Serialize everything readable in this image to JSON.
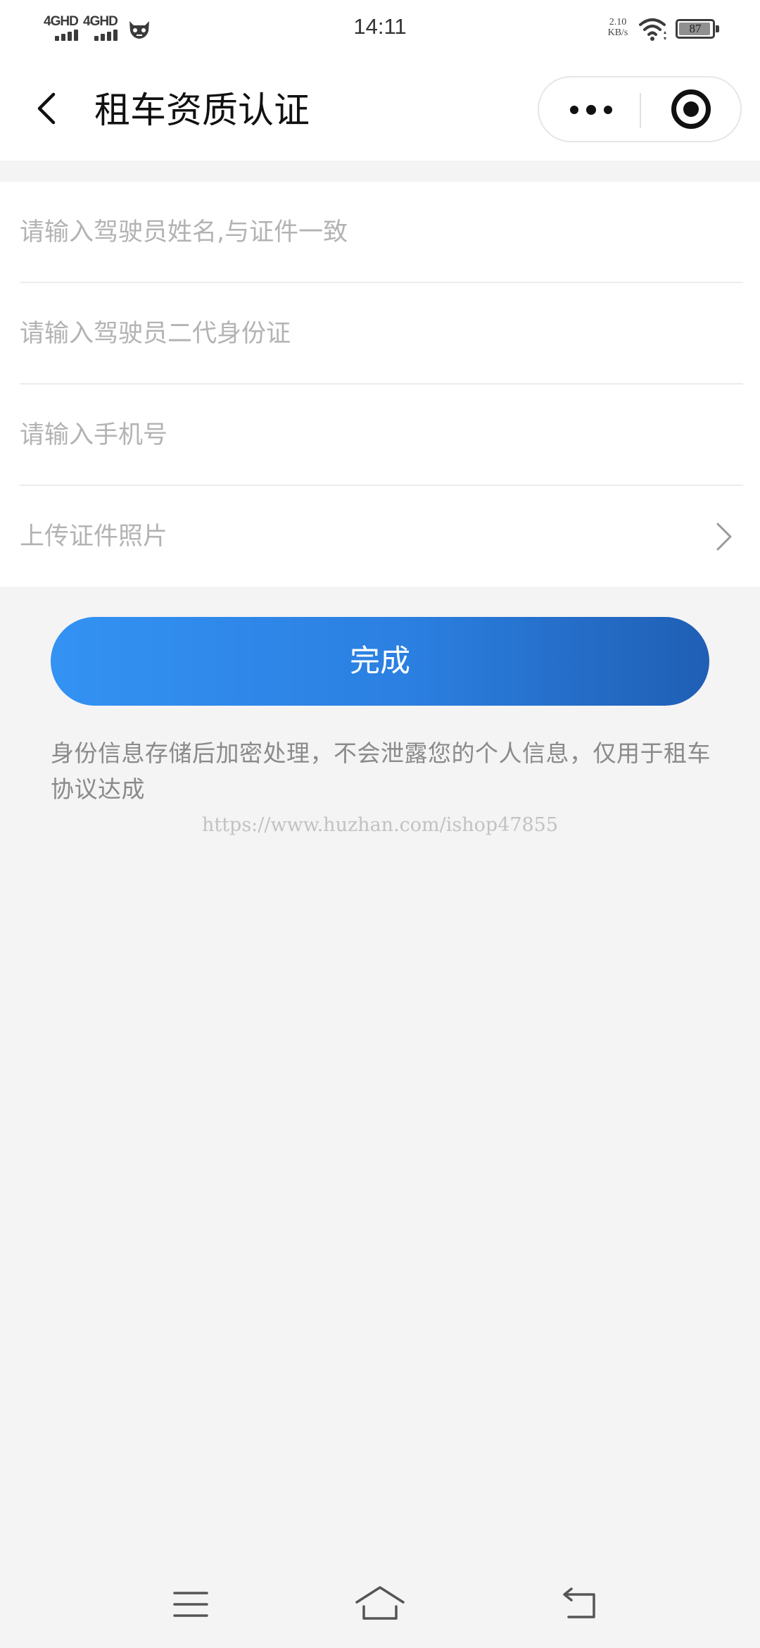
{
  "status_bar": {
    "network_1": "4GHD",
    "network_2": "4GHD",
    "time": "14:11",
    "speed_value": "2.10",
    "speed_unit": "KB/s",
    "battery": "87"
  },
  "nav": {
    "title": "租车资质认证"
  },
  "form": {
    "name_placeholder": "请输入驾驶员姓名,与证件一致",
    "id_placeholder": "请输入驾驶员二代身份证",
    "phone_placeholder": "请输入手机号",
    "upload_label": "上传证件照片"
  },
  "submit_label": "完成",
  "notice": "身份信息存储后加密处理，不会泄露您的个人信息，仅用于租车协议达成",
  "watermark": "https://www.huzhan.com/ishop47855",
  "colors": {
    "button_gradient_start": "#3392f3",
    "button_gradient_end": "#1f5fb4",
    "page_background": "#f4f4f5"
  }
}
